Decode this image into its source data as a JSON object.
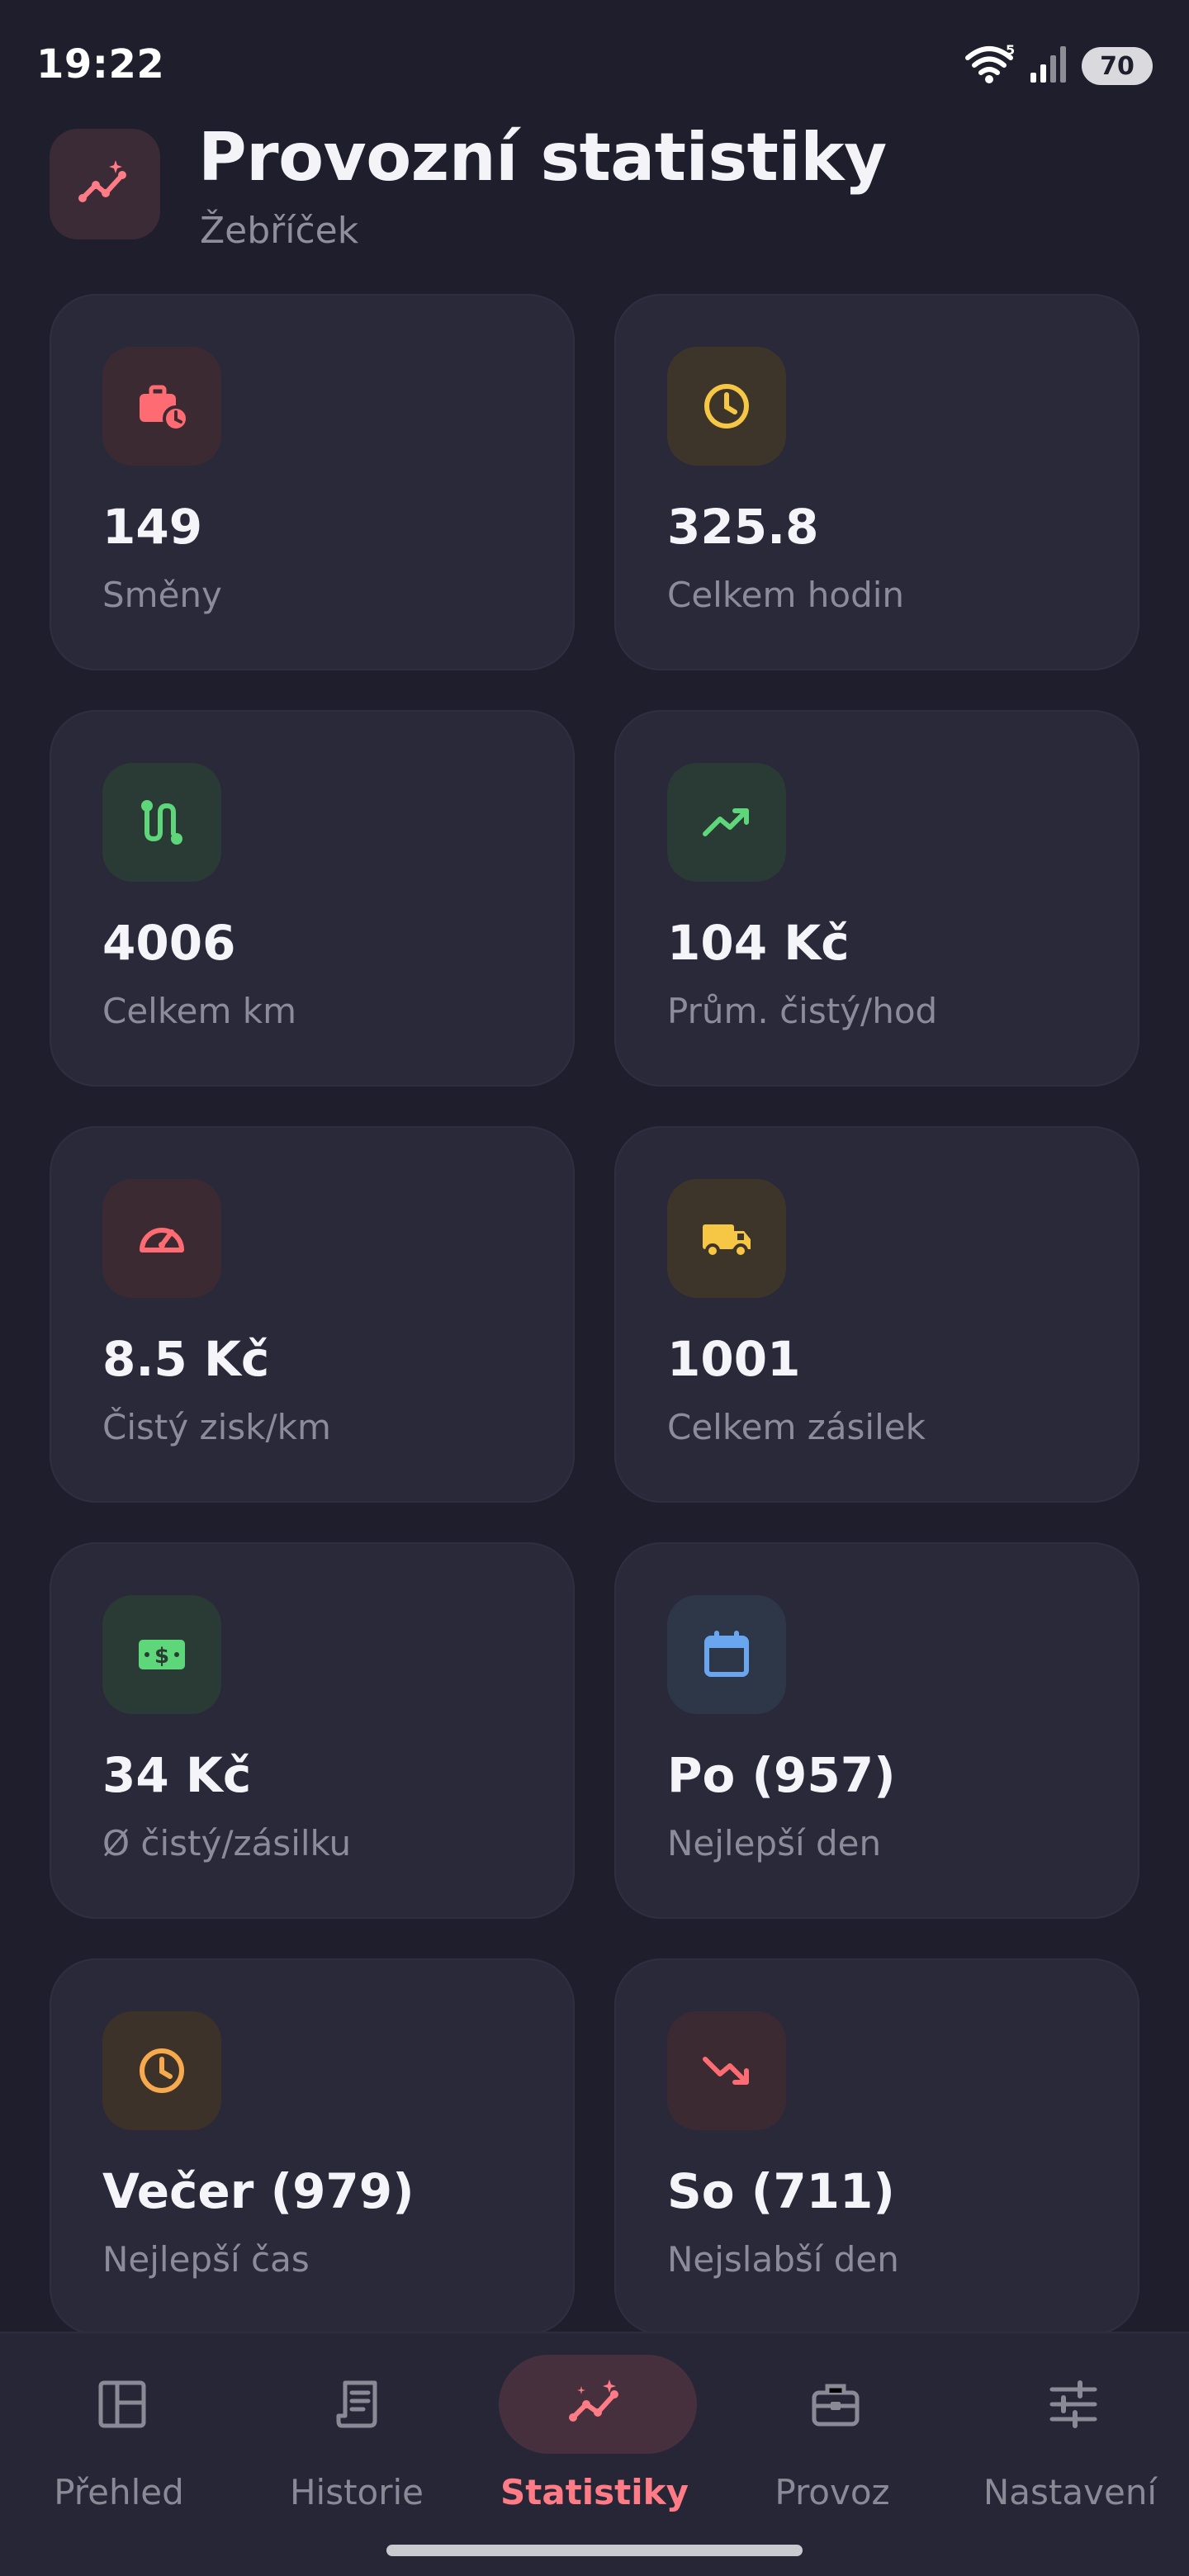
{
  "status_bar": {
    "time": "19:22",
    "battery": "70"
  },
  "header": {
    "title": "Provozní statistiky",
    "subtitle": "Žebříček",
    "icon": "sparkle-chart-icon"
  },
  "stats": [
    {
      "value": "149",
      "label": "Směny",
      "icon": "briefcase-clock-icon",
      "color": "#ff6b72"
    },
    {
      "value": "325.8",
      "label": "Celkem hodin",
      "icon": "clock-icon",
      "color": "#f6c744"
    },
    {
      "value": "4006",
      "label": "Celkem km",
      "icon": "route-icon",
      "color": "#5ed67a"
    },
    {
      "value": "104 Kč",
      "label": "Prům. čistý/hod",
      "icon": "trending-up-icon",
      "color": "#5ed67a"
    },
    {
      "value": "8.5 Kč",
      "label": "Čistý zisk/km",
      "icon": "speedometer-icon",
      "color": "#ff6b72"
    },
    {
      "value": "1001",
      "label": "Celkem zásilek",
      "icon": "truck-icon",
      "color": "#f6c744"
    },
    {
      "value": "34 Kč",
      "label": "Ø čistý/zásilku",
      "icon": "cash-icon",
      "color": "#5ed67a"
    },
    {
      "value": "Po (957)",
      "label": "Nejlepší den",
      "icon": "calendar-icon",
      "color": "#6aa6f0"
    },
    {
      "value": "Večer (979)",
      "label": "Nejlepší čas",
      "icon": "clock-icon",
      "color": "#f7a94d"
    },
    {
      "value": "So (711)",
      "label": "Nejslabší den",
      "icon": "trending-down-icon",
      "color": "#ff6b72"
    }
  ],
  "nav": [
    {
      "label": "Přehled",
      "icon": "dashboard-icon",
      "active": false
    },
    {
      "label": "Historie",
      "icon": "receipt-icon",
      "active": false
    },
    {
      "label": "Statistiky",
      "icon": "sparkle-chart-icon",
      "active": true
    },
    {
      "label": "Provoz",
      "icon": "toolbox-icon",
      "active": false
    },
    {
      "label": "Nastavení",
      "icon": "sliders-icon",
      "active": false
    }
  ],
  "colors": {
    "accent": "#ff7b86",
    "background": "#1e1e2c",
    "card": "#292939"
  }
}
